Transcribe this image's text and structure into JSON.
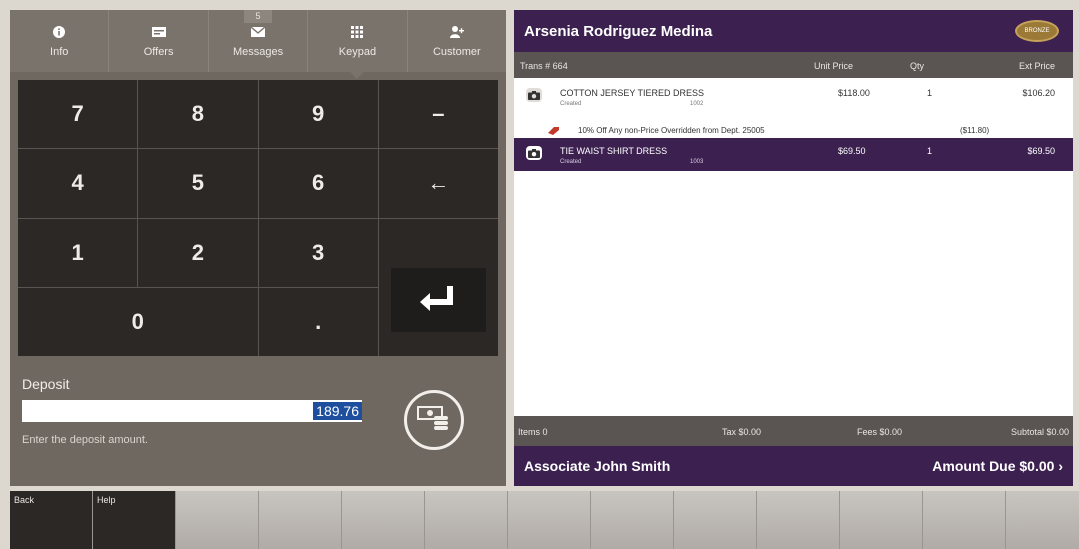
{
  "tabs": [
    {
      "label": "Info",
      "icon": "info-icon"
    },
    {
      "label": "Offers",
      "icon": "offers-icon"
    },
    {
      "label": "Messages",
      "icon": "envelope-icon",
      "badge": "5"
    },
    {
      "label": "Keypad",
      "icon": "keypad-icon",
      "active": true
    },
    {
      "label": "Customer",
      "icon": "customer-icon"
    }
  ],
  "keypad": {
    "keys": [
      "7",
      "8",
      "9",
      "–",
      "4",
      "5",
      "6",
      "←",
      "1",
      "2",
      "3",
      "0",
      "."
    ]
  },
  "deposit": {
    "title": "Deposit",
    "value": "189.76",
    "hint": "Enter the deposit amount."
  },
  "customer": {
    "name": "Arsenia  Rodriguez Medina",
    "tier": "BRONZE"
  },
  "columns": {
    "trans": "Trans # 664",
    "unit_price": "Unit Price",
    "qty": "Qty",
    "ext_price": "Ext Price"
  },
  "items": [
    {
      "name": "COTTON JERSEY TIERED DRESS",
      "status": "Created",
      "sku": "1002",
      "unit": "$118.00",
      "qty": "1",
      "ext": "$106.20"
    },
    {
      "name": "TIE WAIST SHIRT DRESS",
      "status": "Created",
      "sku": "1003",
      "unit": "$69.50",
      "qty": "1",
      "ext": "$69.50"
    }
  ],
  "discount": {
    "text": "10% Off Any non-Price Overridden from Dept. 25005",
    "amount": "($11.80)"
  },
  "totals": {
    "items": "Items 0",
    "tax": "Tax $0.00",
    "fees": "Fees $0.00",
    "subtotal": "Subtotal $0.00"
  },
  "footer": {
    "associate": "Associate John  Smith",
    "amount_due": "Amount Due  $0.00 ›"
  },
  "function_keys": [
    "Back",
    "Help",
    "",
    "",
    "",
    "",
    "",
    "",
    "",
    "",
    "",
    "",
    ""
  ],
  "colors": {
    "accent_purple": "#3c2150",
    "panel_gray": "#6f6861",
    "key_dark": "#2b2826",
    "selection_blue": "#1e4f9e"
  }
}
